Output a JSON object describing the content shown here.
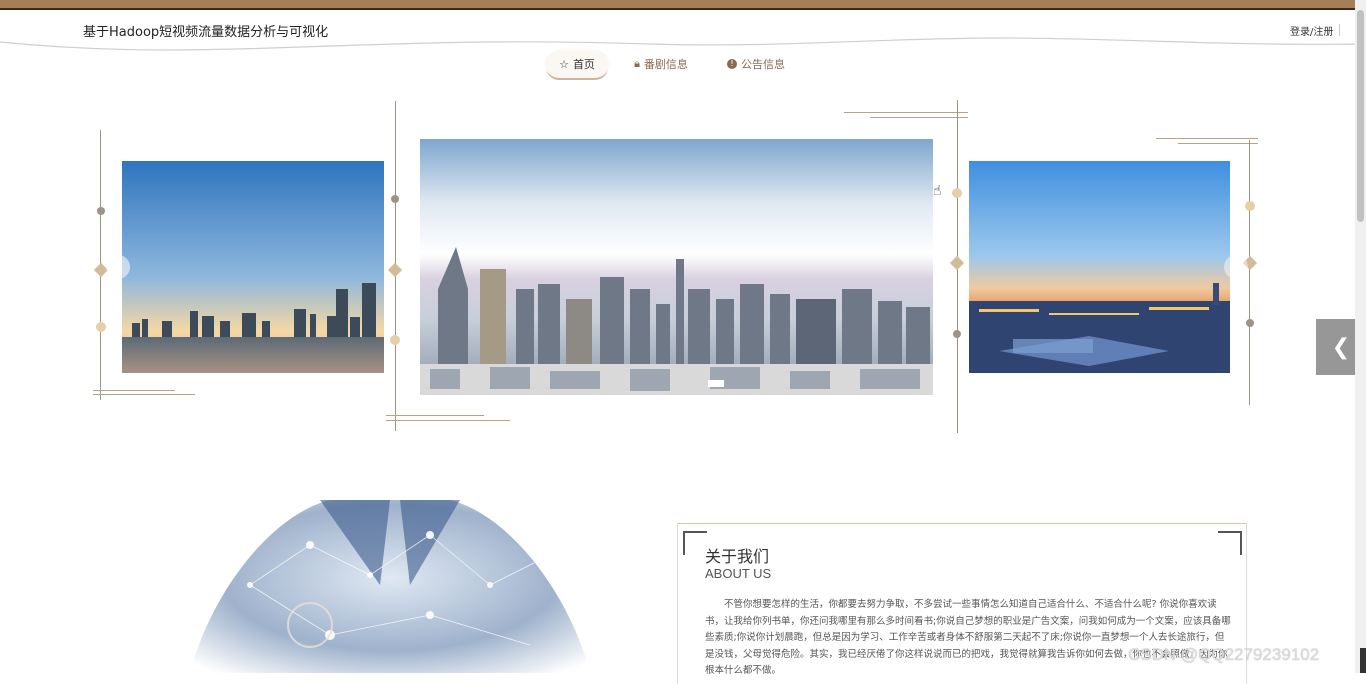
{
  "header": {
    "site_title": "基于Hadoop短视频流量数据分析与可视化",
    "login_link": "登录/注册"
  },
  "nav": {
    "items": [
      {
        "label": "首页",
        "icon": "star-icon",
        "active": true
      },
      {
        "label": "番剧信息",
        "icon": "bag-icon",
        "active": false
      },
      {
        "label": "公告信息",
        "icon": "info-icon",
        "active": false
      }
    ]
  },
  "carousel": {
    "slides": [
      "city-skyline-sunset",
      "city-aerial-day",
      "city-evening-lights"
    ],
    "active_slide": 2,
    "next_icon": "chevron-left-icon"
  },
  "about": {
    "title": "关于我们",
    "subtitle": "ABOUT US",
    "text": "不管你想要怎样的生活，你都要去努力争取，不多尝试一些事情怎么知道自己适合什么、不适合什么呢? 你说你喜欢读书，让我给你列书单，你还问我哪里有那么多时间看书;你说自己梦想的职业是广告文案，问我如何成为一个文案，应该具备哪些素质;你说你计划晨跑，但总是因为学习、工作辛苦或者身体不舒服第二天起不了床;你说你一直梦想一个人去长途旅行，但是没钱，父母觉得危险。其实，我已经厌倦了你这样说说而已的把戏，我觉得就算我告诉你如何去做，你也不会照做，因为你根本什么都不做。"
  },
  "watermark": "CSDN @QQ2279239102",
  "colors": {
    "brand_brown": "#a57e5a",
    "gold_accent": "#d2bb99",
    "nav_text": "#8a6b50"
  }
}
